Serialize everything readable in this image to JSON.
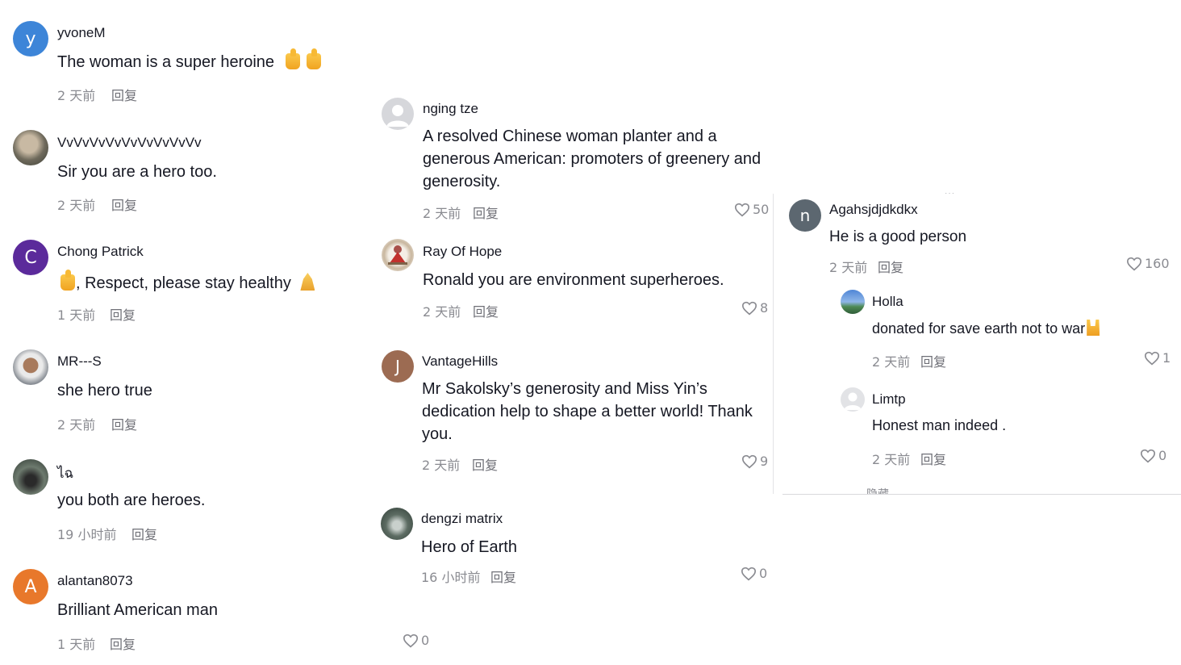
{
  "colors": {
    "text_primary": "#161823",
    "text_meta": "#8a8b91",
    "reply": "#6f7077",
    "avatar_blue": "#3d85d8",
    "avatar_purple": "#5b2a9b",
    "avatar_orange": "#e8782b",
    "avatar_brown": "#9c6b52",
    "avatar_slate": "#5c6770"
  },
  "left_column": {
    "comments": [
      {
        "avatar_letter": "y",
        "username": "yvoneM",
        "text": "The woman is a super heroine",
        "emoji": "thumbs-up-icon x2",
        "time": "2 天前",
        "reply": "回复"
      },
      {
        "avatar_letter": "",
        "username": "VvVvVvVvVvVvVvVvVv",
        "text": "Sir you are a hero too.",
        "time": "2 天前",
        "reply": "回复"
      },
      {
        "avatar_letter": "C",
        "username": "Chong Patrick",
        "text_prefix": ", Respect, please stay healthy",
        "emoji": "thumbs-up-icon, pray-icon",
        "time": "1 天前",
        "reply": "回复"
      },
      {
        "avatar_letter": "",
        "username": "MR---S",
        "text": "she hero true",
        "time": "2 天前",
        "reply": "回复"
      },
      {
        "avatar_letter": "",
        "username": "ไฉ",
        "text": "you both are heroes.",
        "time": "19 小时前",
        "reply": "回复"
      },
      {
        "avatar_letter": "A",
        "username": "alantan8073",
        "text": "Brilliant American man",
        "time": "1 天前",
        "reply": "回复"
      }
    ]
  },
  "middle_column": {
    "comments": [
      {
        "avatar_letter": "",
        "username": "nging tze",
        "text": "A resolved Chinese woman planter and a generous American: promoters of greenery and generosity.",
        "time": "2 天前",
        "reply": "回复",
        "likes": "50"
      },
      {
        "avatar_letter": "",
        "username": "Ray Of Hope",
        "text": "Ronald you are environment superheroes.",
        "time": "2 天前",
        "reply": "回复",
        "likes": "8"
      },
      {
        "avatar_letter": "J",
        "username": "VantageHills",
        "text": "Mr Sakolsky’s generosity and Miss Yin’s dedication help to shape a better world! Thank you.",
        "time": "2 天前",
        "reply": "回复",
        "likes": "9"
      },
      {
        "avatar_letter": "",
        "username": "dengzi matrix",
        "text": "Hero of Earth",
        "time": "16 小时前",
        "reply": "回复",
        "likes": "0"
      }
    ],
    "bottom_likes": "0"
  },
  "right_column": {
    "top_clip": "…",
    "comment": {
      "avatar_letter": "n",
      "username": "Agahsjdjdkdkx",
      "text": "He is a good person",
      "time": "2 天前",
      "reply": "回复",
      "likes": "160"
    },
    "replies": [
      {
        "avatar_letter": "",
        "username": "Holla",
        "text": "donated for save earth not to war",
        "emoji": "rock-hand-icon",
        "time": "2 天前",
        "reply": "回复",
        "likes": "1"
      },
      {
        "avatar_letter": "",
        "username": "Limtp",
        "text": "Honest man indeed .",
        "time": "2 天前",
        "reply": "回复",
        "likes": "0"
      }
    ],
    "bottom_clip": "隐藏 ·"
  }
}
